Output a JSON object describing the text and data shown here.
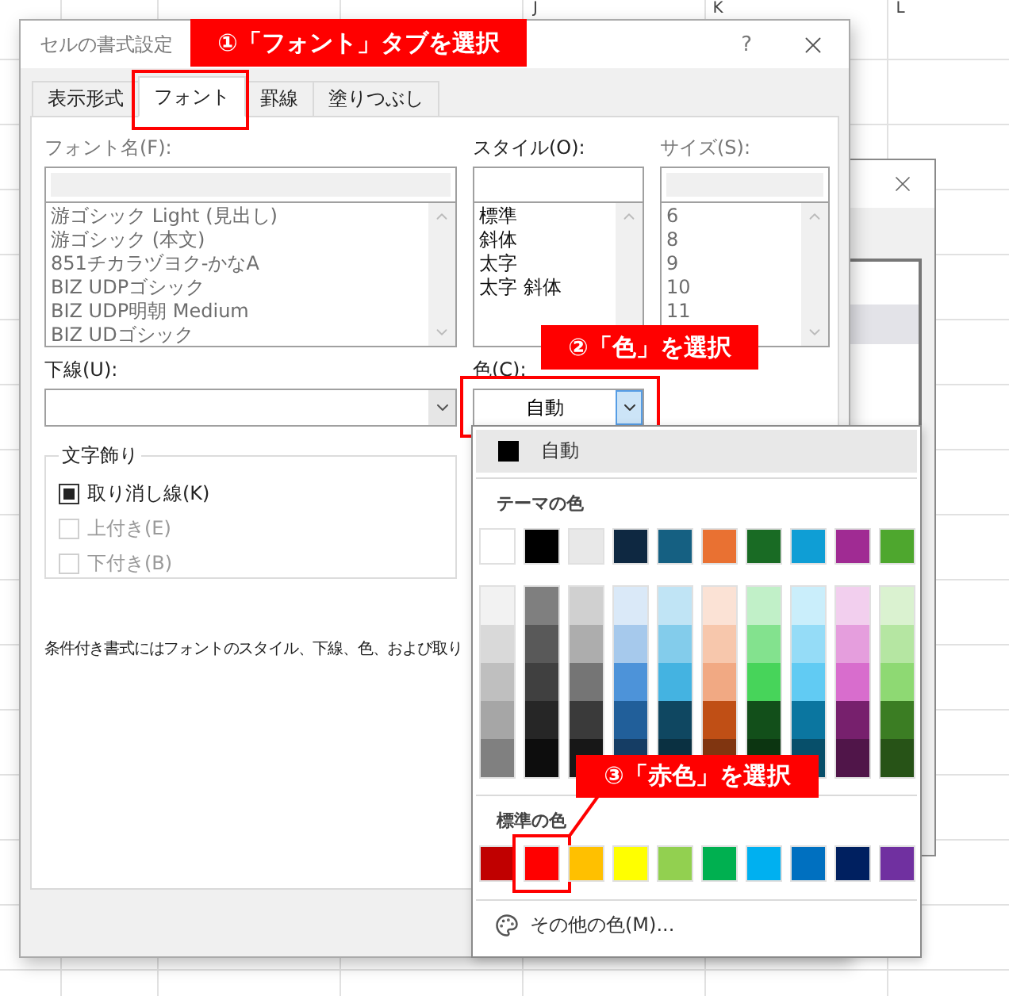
{
  "sheet": {
    "column_headers": [
      "J",
      "K",
      "L"
    ]
  },
  "dialog": {
    "title": "セルの書式設定",
    "help": "?"
  },
  "tabs": [
    {
      "label": "表示形式",
      "selected": false,
      "framed": false
    },
    {
      "label": "フォント",
      "selected": true,
      "framed": true
    },
    {
      "label": "罫線",
      "selected": false,
      "framed": false
    },
    {
      "label": "塗りつぶし",
      "selected": false,
      "framed": false
    }
  ],
  "font_name": {
    "label": "フォント名(F):",
    "disabled": true,
    "items": [
      "游ゴシック Light (見出し)",
      "游ゴシック (本文)",
      "851チカラヅヨク-かなA",
      "BIZ UDPゴシック",
      "BIZ UDP明朝 Medium",
      "BIZ UDゴシック"
    ]
  },
  "style": {
    "label": "スタイル(O):",
    "disabled": false,
    "items": [
      "標準",
      "斜体",
      "太字",
      "太字 斜体"
    ]
  },
  "size": {
    "label": "サイズ(S):",
    "disabled": true,
    "items": [
      "6",
      "8",
      "9",
      "10",
      "11"
    ]
  },
  "underline": {
    "label": "下線(U):"
  },
  "color": {
    "label": "色(C):",
    "value": "自動",
    "open": true,
    "framed": true
  },
  "effects": {
    "title": "文字飾り",
    "options": [
      {
        "label": "取り消し線(K)",
        "mixed": true,
        "disabled": false
      },
      {
        "label": "上付き(E)",
        "mixed": false,
        "disabled": true
      },
      {
        "label": "下付き(B)",
        "mixed": false,
        "disabled": true
      }
    ]
  },
  "note": "条件付き書式にはフォントのスタイル、下線、色、および取り",
  "color_menu": {
    "automatic": {
      "label": "自動",
      "highlighted": true
    },
    "theme_title": "テーマの色",
    "theme_colors": [
      {
        "color": "#ffffff"
      },
      {
        "color": "#000000"
      },
      {
        "color": "#e8e8e8"
      },
      {
        "color": "#0e2841"
      },
      {
        "color": "#156082"
      },
      {
        "color": "#e97132"
      },
      {
        "color": "#196b24"
      },
      {
        "color": "#0f9ed5"
      },
      {
        "color": "#a02b93"
      },
      {
        "color": "#4ea72e"
      }
    ],
    "shades": [
      {
        "colors": [
          {
            "color": "#f2f2f2"
          },
          {
            "color": "#d9d9d9"
          },
          {
            "color": "#bfbfbf"
          },
          {
            "color": "#a6a6a6"
          },
          {
            "color": "#808080"
          }
        ]
      },
      {
        "colors": [
          {
            "color": "#7f7f7f"
          },
          {
            "color": "#595959"
          },
          {
            "color": "#404040"
          },
          {
            "color": "#262626"
          },
          {
            "color": "#0d0d0d"
          }
        ]
      },
      {
        "colors": [
          {
            "color": "#d0d0d0"
          },
          {
            "color": "#adadad"
          },
          {
            "color": "#757575"
          },
          {
            "color": "#3a3a3a"
          },
          {
            "color": "#171717"
          }
        ]
      },
      {
        "colors": [
          {
            "color": "#dae9f8"
          },
          {
            "color": "#a6c9ec"
          },
          {
            "color": "#4d93d9"
          },
          {
            "color": "#215f9a"
          },
          {
            "color": "#153d64"
          }
        ]
      },
      {
        "colors": [
          {
            "color": "#c0e4f5"
          },
          {
            "color": "#83cceb"
          },
          {
            "color": "#44b3e1"
          },
          {
            "color": "#0f4761"
          },
          {
            "color": "#0a3041"
          }
        ]
      },
      {
        "colors": [
          {
            "color": "#fbe2d5"
          },
          {
            "color": "#f7c7ac"
          },
          {
            "color": "#f1a983"
          },
          {
            "color": "#c04f15"
          },
          {
            "color": "#803510"
          }
        ]
      },
      {
        "colors": [
          {
            "color": "#c1f0c8"
          },
          {
            "color": "#83e28e"
          },
          {
            "color": "#47d45a"
          },
          {
            "color": "#124f1a"
          },
          {
            "color": "#0c3511"
          }
        ]
      },
      {
        "colors": [
          {
            "color": "#caeefb"
          },
          {
            "color": "#95dcf7"
          },
          {
            "color": "#61cbf3"
          },
          {
            "color": "#0b76a0"
          },
          {
            "color": "#074f6a"
          }
        ]
      },
      {
        "colors": [
          {
            "color": "#f2cfee"
          },
          {
            "color": "#e59edd"
          },
          {
            "color": "#d86dcd"
          },
          {
            "color": "#77206d"
          },
          {
            "color": "#501549"
          }
        ]
      },
      {
        "colors": [
          {
            "color": "#daf2d0"
          },
          {
            "color": "#b5e6a2"
          },
          {
            "color": "#8ed973"
          },
          {
            "color": "#3b7d23"
          },
          {
            "color": "#275317"
          }
        ]
      }
    ],
    "standard_title": "標準の色",
    "standard_colors": [
      {
        "color": "#c00000",
        "framed": false
      },
      {
        "color": "#ff0000",
        "framed": true
      },
      {
        "color": "#ffc000",
        "framed": false
      },
      {
        "color": "#ffff00",
        "framed": false
      },
      {
        "color": "#92d050",
        "framed": false
      },
      {
        "color": "#00b050",
        "framed": false
      },
      {
        "color": "#00b0f0",
        "framed": false
      },
      {
        "color": "#0070c0",
        "framed": false
      },
      {
        "color": "#002060",
        "framed": false
      },
      {
        "color": "#7030a0",
        "framed": false
      }
    ],
    "more": "その他の色(M)..."
  },
  "callouts": [
    {
      "text": "①「フォント」タブを選択",
      "pointer": false
    },
    {
      "text": "②「色」を選択",
      "pointer": false
    },
    {
      "text": "③「赤色」を選択",
      "pointer": true
    }
  ]
}
